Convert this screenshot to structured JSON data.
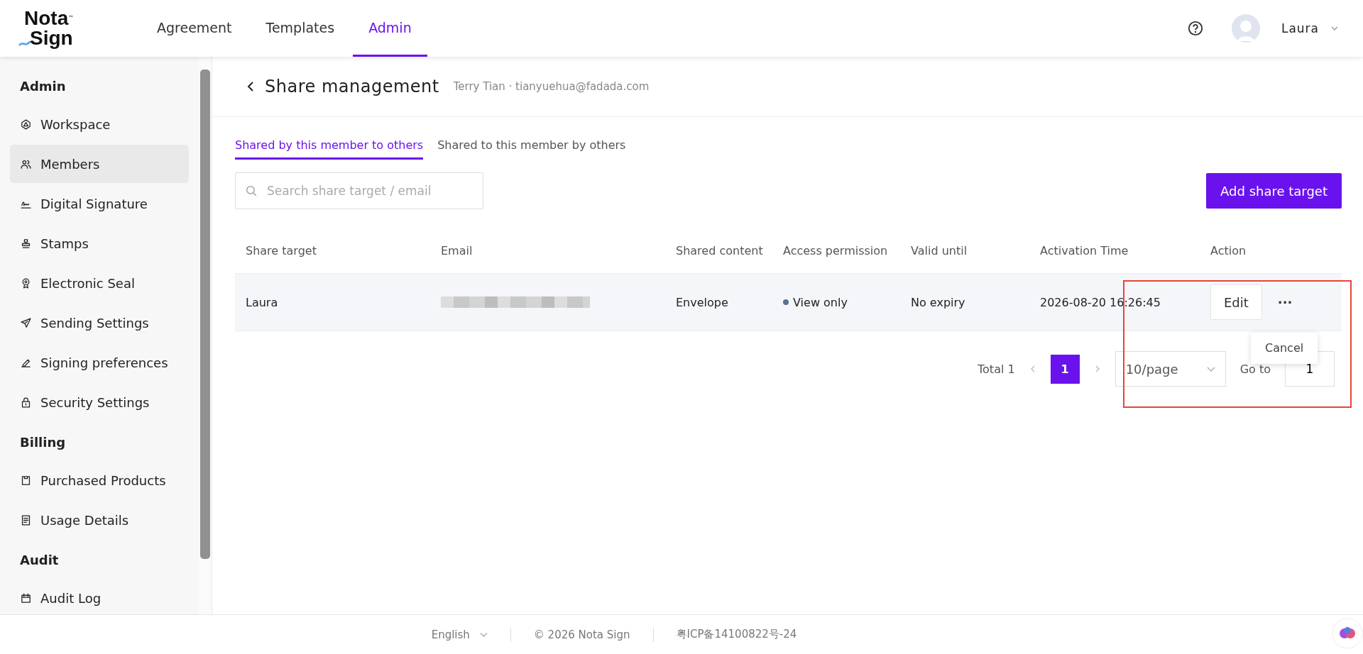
{
  "header": {
    "logo": {
      "line1": "Nota",
      "line2": "Sign",
      "mark": "™"
    },
    "nav": [
      {
        "label": "Agreement",
        "selected": false
      },
      {
        "label": "Templates",
        "selected": false
      },
      {
        "label": "Admin",
        "selected": true
      }
    ],
    "user": {
      "name": "Laura"
    }
  },
  "sidebar": {
    "sections": [
      {
        "title": "Admin",
        "items": [
          {
            "label": "Workspace",
            "selected": false
          },
          {
            "label": "Members",
            "selected": true
          },
          {
            "label": "Digital Signature",
            "selected": false
          },
          {
            "label": "Stamps",
            "selected": false
          },
          {
            "label": "Electronic Seal",
            "selected": false
          },
          {
            "label": "Sending Settings",
            "selected": false
          },
          {
            "label": "Signing preferences",
            "selected": false
          },
          {
            "label": "Security Settings",
            "selected": false
          }
        ]
      },
      {
        "title": "Billing",
        "items": [
          {
            "label": "Purchased Products",
            "selected": false
          },
          {
            "label": "Usage Details",
            "selected": false
          }
        ]
      },
      {
        "title": "Audit",
        "items": [
          {
            "label": "Audit Log",
            "selected": false
          }
        ]
      }
    ]
  },
  "page": {
    "title": "Share management",
    "subtitle": "Terry Tian · tianyuehua@fadada.com",
    "tabs": [
      {
        "label": "Shared by this member to others",
        "selected": true
      },
      {
        "label": "Shared to this member by others",
        "selected": false
      }
    ],
    "search": {
      "placeholder": "Search share target / email"
    },
    "add_button": "Add share target",
    "table": {
      "columns": [
        "Share target",
        "Email",
        "Shared content",
        "Access permission",
        "Valid until",
        "Activation Time",
        "Action"
      ],
      "rows": [
        {
          "share_target": "Laura",
          "email_redacted": true,
          "shared_content": "Envelope",
          "permission": {
            "text": "View only",
            "color": "#5b7193"
          },
          "valid_until": "No expiry",
          "activation_time": "2026-08-20 16:26:45",
          "edit": "Edit",
          "more": "···",
          "menu_open": true,
          "menu_items": [
            "Cancel"
          ]
        }
      ]
    },
    "pagination": {
      "total": "Total 1",
      "pages": [
        {
          "label": "1",
          "selected": true
        }
      ],
      "page_size": "10/page",
      "goto_label": "Go to",
      "goto_value": "1"
    },
    "highlight_frame": true
  },
  "footer": {
    "language": "English",
    "copyright": "© 2026 Nota Sign",
    "icp": "粤ICP备14100822号-24"
  }
}
